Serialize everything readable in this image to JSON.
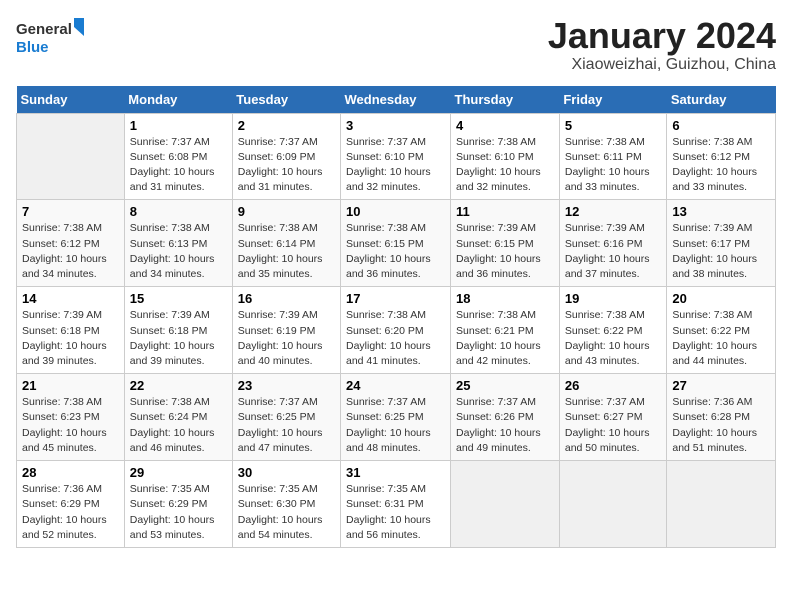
{
  "header": {
    "logo_line1": "General",
    "logo_line2": "Blue",
    "month_title": "January 2024",
    "location": "Xiaoweizhai, Guizhou, China"
  },
  "weekdays": [
    "Sunday",
    "Monday",
    "Tuesday",
    "Wednesday",
    "Thursday",
    "Friday",
    "Saturday"
  ],
  "weeks": [
    [
      {
        "num": "",
        "info": ""
      },
      {
        "num": "1",
        "info": "Sunrise: 7:37 AM\nSunset: 6:08 PM\nDaylight: 10 hours\nand 31 minutes."
      },
      {
        "num": "2",
        "info": "Sunrise: 7:37 AM\nSunset: 6:09 PM\nDaylight: 10 hours\nand 31 minutes."
      },
      {
        "num": "3",
        "info": "Sunrise: 7:37 AM\nSunset: 6:10 PM\nDaylight: 10 hours\nand 32 minutes."
      },
      {
        "num": "4",
        "info": "Sunrise: 7:38 AM\nSunset: 6:10 PM\nDaylight: 10 hours\nand 32 minutes."
      },
      {
        "num": "5",
        "info": "Sunrise: 7:38 AM\nSunset: 6:11 PM\nDaylight: 10 hours\nand 33 minutes."
      },
      {
        "num": "6",
        "info": "Sunrise: 7:38 AM\nSunset: 6:12 PM\nDaylight: 10 hours\nand 33 minutes."
      }
    ],
    [
      {
        "num": "7",
        "info": "Sunrise: 7:38 AM\nSunset: 6:12 PM\nDaylight: 10 hours\nand 34 minutes."
      },
      {
        "num": "8",
        "info": "Sunrise: 7:38 AM\nSunset: 6:13 PM\nDaylight: 10 hours\nand 34 minutes."
      },
      {
        "num": "9",
        "info": "Sunrise: 7:38 AM\nSunset: 6:14 PM\nDaylight: 10 hours\nand 35 minutes."
      },
      {
        "num": "10",
        "info": "Sunrise: 7:38 AM\nSunset: 6:15 PM\nDaylight: 10 hours\nand 36 minutes."
      },
      {
        "num": "11",
        "info": "Sunrise: 7:39 AM\nSunset: 6:15 PM\nDaylight: 10 hours\nand 36 minutes."
      },
      {
        "num": "12",
        "info": "Sunrise: 7:39 AM\nSunset: 6:16 PM\nDaylight: 10 hours\nand 37 minutes."
      },
      {
        "num": "13",
        "info": "Sunrise: 7:39 AM\nSunset: 6:17 PM\nDaylight: 10 hours\nand 38 minutes."
      }
    ],
    [
      {
        "num": "14",
        "info": "Sunrise: 7:39 AM\nSunset: 6:18 PM\nDaylight: 10 hours\nand 39 minutes."
      },
      {
        "num": "15",
        "info": "Sunrise: 7:39 AM\nSunset: 6:18 PM\nDaylight: 10 hours\nand 39 minutes."
      },
      {
        "num": "16",
        "info": "Sunrise: 7:39 AM\nSunset: 6:19 PM\nDaylight: 10 hours\nand 40 minutes."
      },
      {
        "num": "17",
        "info": "Sunrise: 7:38 AM\nSunset: 6:20 PM\nDaylight: 10 hours\nand 41 minutes."
      },
      {
        "num": "18",
        "info": "Sunrise: 7:38 AM\nSunset: 6:21 PM\nDaylight: 10 hours\nand 42 minutes."
      },
      {
        "num": "19",
        "info": "Sunrise: 7:38 AM\nSunset: 6:22 PM\nDaylight: 10 hours\nand 43 minutes."
      },
      {
        "num": "20",
        "info": "Sunrise: 7:38 AM\nSunset: 6:22 PM\nDaylight: 10 hours\nand 44 minutes."
      }
    ],
    [
      {
        "num": "21",
        "info": "Sunrise: 7:38 AM\nSunset: 6:23 PM\nDaylight: 10 hours\nand 45 minutes."
      },
      {
        "num": "22",
        "info": "Sunrise: 7:38 AM\nSunset: 6:24 PM\nDaylight: 10 hours\nand 46 minutes."
      },
      {
        "num": "23",
        "info": "Sunrise: 7:37 AM\nSunset: 6:25 PM\nDaylight: 10 hours\nand 47 minutes."
      },
      {
        "num": "24",
        "info": "Sunrise: 7:37 AM\nSunset: 6:25 PM\nDaylight: 10 hours\nand 48 minutes."
      },
      {
        "num": "25",
        "info": "Sunrise: 7:37 AM\nSunset: 6:26 PM\nDaylight: 10 hours\nand 49 minutes."
      },
      {
        "num": "26",
        "info": "Sunrise: 7:37 AM\nSunset: 6:27 PM\nDaylight: 10 hours\nand 50 minutes."
      },
      {
        "num": "27",
        "info": "Sunrise: 7:36 AM\nSunset: 6:28 PM\nDaylight: 10 hours\nand 51 minutes."
      }
    ],
    [
      {
        "num": "28",
        "info": "Sunrise: 7:36 AM\nSunset: 6:29 PM\nDaylight: 10 hours\nand 52 minutes."
      },
      {
        "num": "29",
        "info": "Sunrise: 7:35 AM\nSunset: 6:29 PM\nDaylight: 10 hours\nand 53 minutes."
      },
      {
        "num": "30",
        "info": "Sunrise: 7:35 AM\nSunset: 6:30 PM\nDaylight: 10 hours\nand 54 minutes."
      },
      {
        "num": "31",
        "info": "Sunrise: 7:35 AM\nSunset: 6:31 PM\nDaylight: 10 hours\nand 56 minutes."
      },
      {
        "num": "",
        "info": ""
      },
      {
        "num": "",
        "info": ""
      },
      {
        "num": "",
        "info": ""
      }
    ]
  ]
}
